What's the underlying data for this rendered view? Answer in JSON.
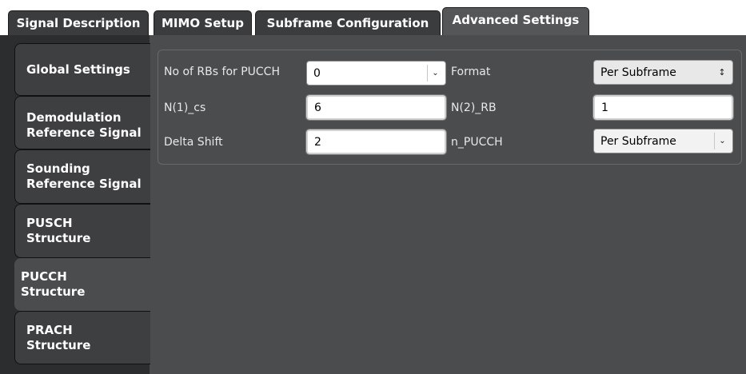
{
  "top_tabs": [
    {
      "label": "Signal Description"
    },
    {
      "label": "MIMO Setup"
    },
    {
      "label": "Subframe Configuration"
    },
    {
      "label": "Advanced Settings"
    }
  ],
  "side_tabs": [
    {
      "label_lines": [
        "Global Settings"
      ]
    },
    {
      "label_lines": [
        "Demodulation",
        "Reference Signal"
      ]
    },
    {
      "label_lines": [
        "Sounding",
        "Reference Signal"
      ]
    },
    {
      "label_lines": [
        "PUSCH",
        "Structure"
      ]
    },
    {
      "label_lines": [
        "PUCCH",
        "Structure"
      ]
    },
    {
      "label_lines": [
        "PRACH",
        "Structure"
      ]
    }
  ],
  "pucch": {
    "no_rbs": {
      "label": "No of RBs for PUCCH",
      "value": "0"
    },
    "format": {
      "label": "Format",
      "value": "Per Subframe"
    },
    "n1_cs": {
      "label": "N(1)_cs",
      "value": "6"
    },
    "n2_rb": {
      "label": "N(2)_RB",
      "value": "1"
    },
    "delta_shift": {
      "label": "Delta Shift",
      "value": "2"
    },
    "n_pucch": {
      "label": "n_PUCCH",
      "value": "Per Subframe"
    }
  },
  "icons": {
    "dropdown": "chevron-down-icon",
    "updown": "up-down-arrows-icon"
  },
  "colors": {
    "background": "#2c2e30",
    "content": "#4a4c4e",
    "tab": "#3d3f41",
    "active_tab": "#545658"
  }
}
